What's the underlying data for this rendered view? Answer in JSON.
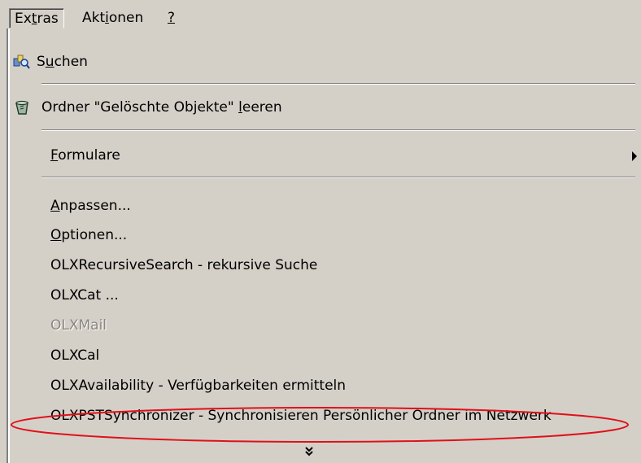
{
  "menubar": {
    "extras": {
      "pre": "Ex",
      "key": "t",
      "post": "ras"
    },
    "aktionen": {
      "pre": "Akt",
      "key": "i",
      "post": "onen"
    },
    "help": {
      "pre": "",
      "key": "?",
      "post": ""
    }
  },
  "menu": {
    "suchen": {
      "pre": "S",
      "key": "u",
      "post": "chen",
      "icon": "search-icon"
    },
    "empty_trash": {
      "pre": "Ordner \"Gelöschte Objekte\" ",
      "key": "l",
      "post": "eeren",
      "icon": "trash-icon"
    },
    "formulare": {
      "pre": "",
      "key": "F",
      "post": "ormulare",
      "icon": "submenu-arrow-icon"
    },
    "anpassen": {
      "pre": "",
      "key": "A",
      "post": "npassen..."
    },
    "optionen": {
      "pre": "",
      "key": "O",
      "post": "ptionen..."
    },
    "olx_recursive": "OLXRecursiveSearch - rekursive Suche",
    "olx_cat": "OLXCat ...",
    "olx_mail": "OLXMail",
    "olx_cal": "OLXCal",
    "olx_availability": "OLXAvailability - Verfügbarkeiten ermitteln",
    "olx_pst": "OLXPSTSynchronizer - Synchronisieren Persönlicher Ordner im Netzwerk",
    "expand_icon": "double-chevron-down-icon"
  },
  "colors": {
    "menu_bg": "#d4d0c8",
    "disabled_text": "#8a8782",
    "annotation_ellipse": "#e0101a"
  }
}
